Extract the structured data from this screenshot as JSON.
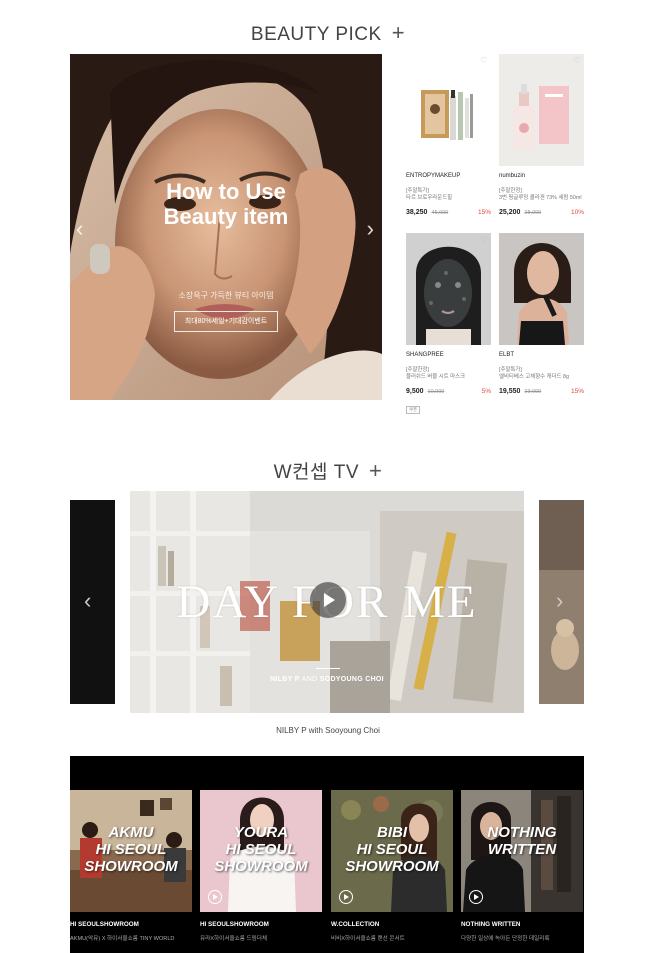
{
  "beauty": {
    "title": "BEAUTY PICK",
    "plus": "+",
    "hero": {
      "line1": "How to Use",
      "line2": "Beauty item",
      "subtitle": "소장욕구 가득한 뷰티 아이템",
      "button": "최대80%세일+기대감이벤트"
    },
    "products": [
      {
        "brand": "ENTROPYMAKEUP",
        "category": "[주말특가]",
        "name": "타르 브로우라운드힐",
        "price": "38,250",
        "original": "45,000",
        "discount": "15%",
        "tag": ""
      },
      {
        "brand": "numbuzin",
        "category": "[주말한정]",
        "name": "3번 핑글루밍 콜라겐 73% 세럼 50ml",
        "price": "25,200",
        "original": "28,000",
        "discount": "10%",
        "tag": ""
      },
      {
        "brand": "SHANGPREE",
        "category": "[주말한정]",
        "name": "블러쉬드 버블 시트 마스크",
        "price": "9,500",
        "original": "10,000",
        "discount": "5%",
        "tag": "쿠폰"
      },
      {
        "brand": "ELBT",
        "category": "[주말특가]",
        "name": "엘비티베스 고체향수 캐더드 8g",
        "price": "19,550",
        "original": "23,000",
        "discount": "15%",
        "tag": ""
      }
    ]
  },
  "tv": {
    "title": "W컨셉 TV",
    "plus": "+",
    "headline": "DAY FOR ME",
    "credit_a": "NILBY P",
    "credit_and": "AND",
    "credit_b": "SODYOUNG CHOI",
    "caption": "NILBY P with Sooyoung Choi"
  },
  "showroom": {
    "cards": [
      {
        "thumb_l1": "AKMU",
        "thumb_l2": "HI SEOUL",
        "thumb_l3": "SHOWROOM",
        "title": "HI SEOULSHOWROOM",
        "desc": "AKMU(악뮤) X 하이서울쇼룸 TINY WORLD"
      },
      {
        "thumb_l1": "YOURA",
        "thumb_l2": "HI SEOUL",
        "thumb_l3": "SHOWROOM",
        "title": "HI SEOULSHOWROOM",
        "desc": "유라X하이서울쇼룸 드림더체"
      },
      {
        "thumb_l1": "BIBI",
        "thumb_l2": "HI SEOUL",
        "thumb_l3": "SHOWROOM",
        "title": "W.COLLECTION",
        "desc": "비비X하이서울쇼룸 랜선 콘서트"
      },
      {
        "thumb_l1": "NOTHING",
        "thumb_l2": "WRITTEN",
        "thumb_l3": "",
        "title": "NOTHING WRITTEN",
        "desc": "다양한 일상에 녹아든 단정한 데일리룩"
      }
    ]
  },
  "icons": {
    "heart": "heart-icon",
    "prev": "chevron-left-icon",
    "next": "chevron-right-icon",
    "play": "play-icon"
  },
  "colors": {
    "discount": "#e04b3b",
    "showroom_bg": "#000000"
  }
}
